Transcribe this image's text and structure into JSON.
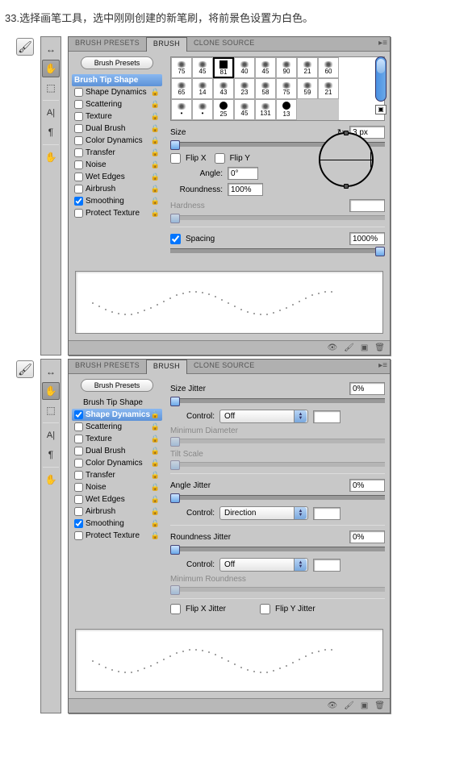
{
  "step_text": "33.选择画笔工具，选中刚刚创建的新笔刷，将前景色设置为白色。",
  "tabs": {
    "presets": "BRUSH PRESETS",
    "brush": "BRUSH",
    "clone": "CLONE SOURCE"
  },
  "sidebar": {
    "presets_btn": "Brush Presets",
    "tip": "Brush Tip Shape",
    "items": [
      {
        "label": "Shape Dynamics"
      },
      {
        "label": "Scattering"
      },
      {
        "label": "Texture"
      },
      {
        "label": "Dual Brush"
      },
      {
        "label": "Color Dynamics"
      },
      {
        "label": "Transfer"
      },
      {
        "label": "Noise"
      },
      {
        "label": "Wet Edges"
      },
      {
        "label": "Airbrush"
      },
      {
        "label": "Smoothing"
      },
      {
        "label": "Protect Texture"
      }
    ]
  },
  "brush_sizes": [
    [
      "75",
      "45",
      "81",
      "40",
      "45",
      "90",
      "21",
      "60"
    ],
    [
      "65",
      "14",
      "43",
      "23",
      "58",
      "75",
      "59",
      "21"
    ],
    [
      "•",
      "•",
      "25",
      "45",
      "131",
      "13",
      "",
      ""
    ]
  ],
  "size": {
    "label": "Size",
    "value": "3 px"
  },
  "flipx": "Flip X",
  "flipy": "Flip Y",
  "angle": {
    "label": "Angle:",
    "value": "0°"
  },
  "roundness": {
    "label": "Roundness:",
    "value": "100%"
  },
  "hardness": {
    "label": "Hardness"
  },
  "spacing": {
    "label": "Spacing",
    "value": "1000%"
  },
  "shape_dyn": {
    "size_jitter": {
      "label": "Size Jitter",
      "value": "0%"
    },
    "control": "Control:",
    "off": "Off",
    "direction": "Direction",
    "min_diam": "Minimum Diameter",
    "tilt": "Tilt Scale",
    "angle_jitter": {
      "label": "Angle Jitter",
      "value": "0%"
    },
    "round_jitter": {
      "label": "Roundness Jitter",
      "value": "0%"
    },
    "min_round": "Minimum Roundness",
    "flipx": "Flip X Jitter",
    "flipy": "Flip Y Jitter"
  }
}
